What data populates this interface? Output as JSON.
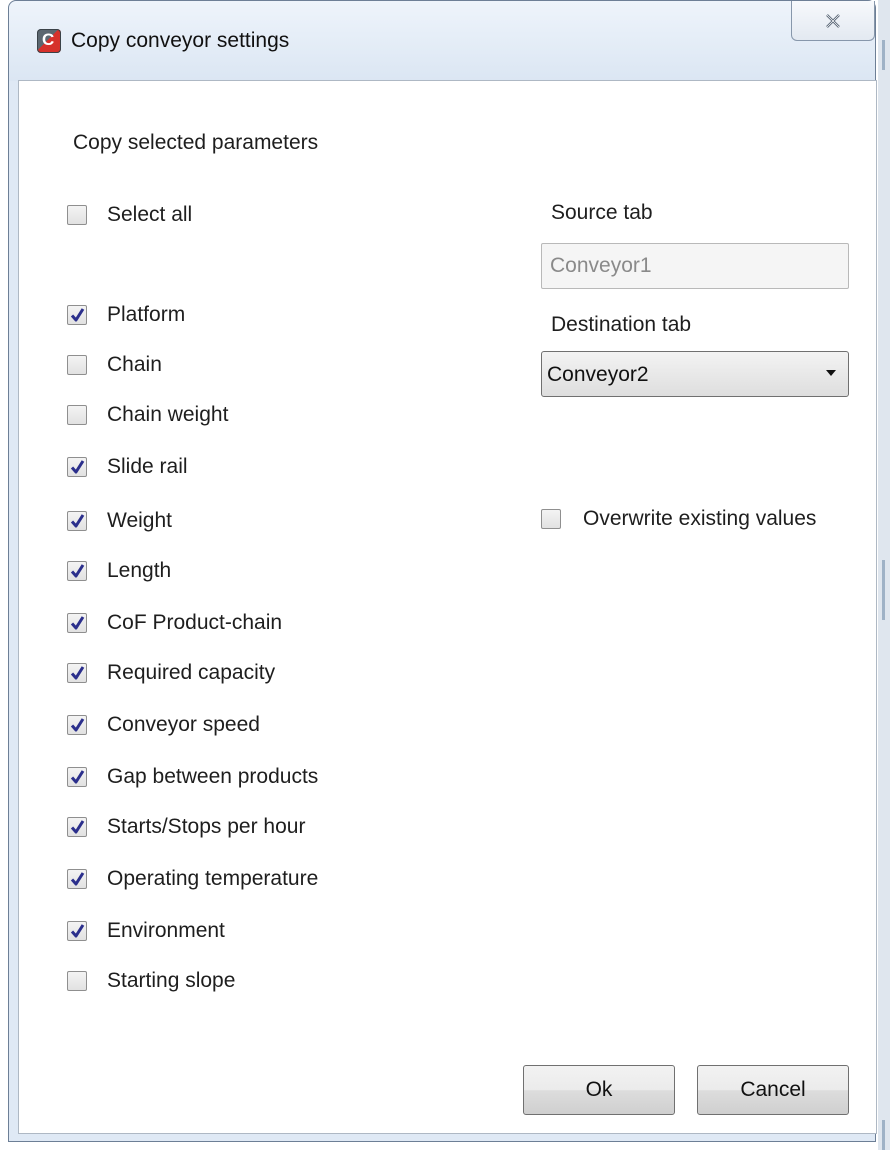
{
  "window": {
    "title": "Copy conveyor settings"
  },
  "heading": "Copy selected parameters",
  "select_all": {
    "label": "Select all",
    "checked": false
  },
  "parameters": [
    {
      "label": "Platform",
      "checked": true
    },
    {
      "label": "Chain",
      "checked": false
    },
    {
      "label": "Chain weight",
      "checked": false
    },
    {
      "label": "Slide rail",
      "checked": true
    },
    {
      "label": "Weight",
      "checked": true
    },
    {
      "label": "Length",
      "checked": true
    },
    {
      "label": "CoF Product-chain",
      "checked": true
    },
    {
      "label": "Required capacity",
      "checked": true
    },
    {
      "label": "Conveyor speed",
      "checked": true
    },
    {
      "label": "Gap between products",
      "checked": true
    },
    {
      "label": "Starts/Stops per hour",
      "checked": true
    },
    {
      "label": "Operating temperature",
      "checked": true
    },
    {
      "label": "Environment",
      "checked": true
    },
    {
      "label": "Starting slope",
      "checked": false
    }
  ],
  "source_tab": {
    "label": "Source tab",
    "value": "Conveyor1"
  },
  "destination_tab": {
    "label": "Destination tab",
    "value": "Conveyor2"
  },
  "overwrite": {
    "label": "Overwrite existing values",
    "checked": false
  },
  "buttons": {
    "ok": "Ok",
    "cancel": "Cancel"
  },
  "colors": {
    "check": "#2b2f8c",
    "frame": "#dfe9f5"
  }
}
